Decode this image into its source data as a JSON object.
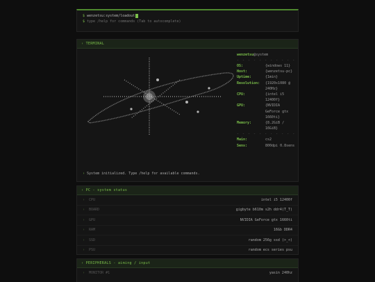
{
  "prompt": {
    "path_line": "wenzetsu:system/loadout",
    "hint_line": "type /help for commands (Tab to autocomplete)"
  },
  "terminal": {
    "header": "TERMINAL",
    "neofetch": {
      "user": "wenzetsu",
      "host_suffix": "@system",
      "separator": "- - - - - - - - - - -",
      "fields": [
        {
          "key": "OS:",
          "value": "{windows 11}"
        },
        {
          "key": "Host:",
          "value": "{wenzetsu-pc}"
        },
        {
          "key": "Uptime:",
          "value": "{1min}"
        },
        {
          "key": "Resolution:",
          "value": "{1920x1080 @ 240Hz}"
        },
        {
          "key": "CPU:",
          "value": "{intel i5 12400f}"
        },
        {
          "key": "GPU:",
          "value": "{NVIDIA GeForce gtx 1660ti}"
        },
        {
          "key": "Memory:",
          "value": "{8.2GiB / 16GiB}"
        }
      ],
      "extra_fields": [
        {
          "key": "Main:",
          "value": "cs2"
        },
        {
          "key": "Sens:",
          "value": "800dpi 0.8sens"
        }
      ]
    },
    "status_message": "System initialized. Type /help for available commands."
  },
  "pc_status": {
    "header": "PC - system status",
    "rows": [
      {
        "label": "CPU",
        "value": "intel i5 12400f"
      },
      {
        "label": "BOARD",
        "value": "gigbyte b610m s2h ddr4(T_T)"
      },
      {
        "label": "GPU",
        "value": "NVIDIA GeForce gtx 1660ti"
      },
      {
        "label": "RAM",
        "value": "16Gb DDR4"
      },
      {
        "label": "SSD",
        "value": "random 256g ssd (>_<)"
      },
      {
        "label": "PSU",
        "value": "random ecs series psu"
      }
    ]
  },
  "peripherals": {
    "header": "PERIPHERALS - aiming / input",
    "rows": [
      {
        "label": "MONITOR #1",
        "value": "yasin 240hz"
      }
    ]
  },
  "colors": {
    "accent": "#7bbf4a",
    "background": "#0e0e0e",
    "panel": "#151515"
  }
}
